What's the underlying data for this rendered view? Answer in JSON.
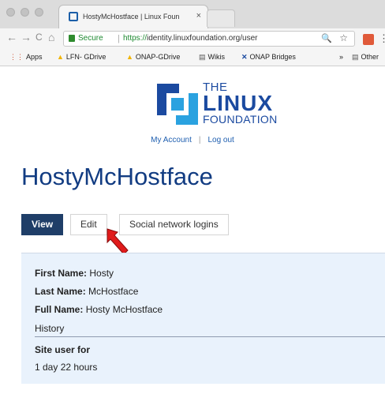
{
  "browser": {
    "tab_title": "HostyMcHostface | Linux Foun",
    "tab_close": "×",
    "nav": {
      "back": "←",
      "forward": "→",
      "reload": "C",
      "home": "⌂"
    },
    "address": {
      "secure_label": "Secure",
      "separator": "|",
      "url_scheme": "https://",
      "url_rest": "identity.linuxfoundation.org/user"
    },
    "zoom_icon": "🔍",
    "star_icon": "☆",
    "menu_icon": "⋮",
    "bookmarks": [
      {
        "icon": "⋮⋮",
        "label": "Apps"
      },
      {
        "icon": "▲",
        "label": "LFN- GDrive"
      },
      {
        "icon": "▲",
        "label": "ONAP-GDrive"
      },
      {
        "icon": "▤",
        "label": "Wikis"
      },
      {
        "icon": "✕",
        "label": "ONAP Bridges"
      }
    ],
    "more_bookmarks": "»",
    "other_bookmarks": "Other"
  },
  "site": {
    "logo": {
      "line1": "THE",
      "line2": "LINUX",
      "line3": "FOUNDATION",
      "color": "#1b4aa0"
    },
    "user_links": {
      "my_account": "My Account",
      "log_out": "Log out",
      "divider": "|"
    },
    "page_title": "HostyMcHostface",
    "tabs": [
      {
        "label": "View",
        "active": true
      },
      {
        "label": "Edit",
        "active": false
      },
      {
        "label": "Social network logins",
        "active": false
      }
    ],
    "profile": {
      "first_name_label": "First Name:",
      "first_name": "Hosty",
      "last_name_label": "Last Name:",
      "last_name": "McHostface",
      "full_name_label": "Full Name:",
      "full_name": "Hosty McHostface",
      "history_label": "History",
      "site_user_label": "Site user for",
      "site_user_value": "1 day 22 hours"
    }
  },
  "colors": {
    "title_blue": "#123c82",
    "active_tab": "#1f3e68",
    "panel_bg": "#e9f2fc",
    "arrow_red": "#e01b1b",
    "secure_green": "#1f8a32"
  }
}
